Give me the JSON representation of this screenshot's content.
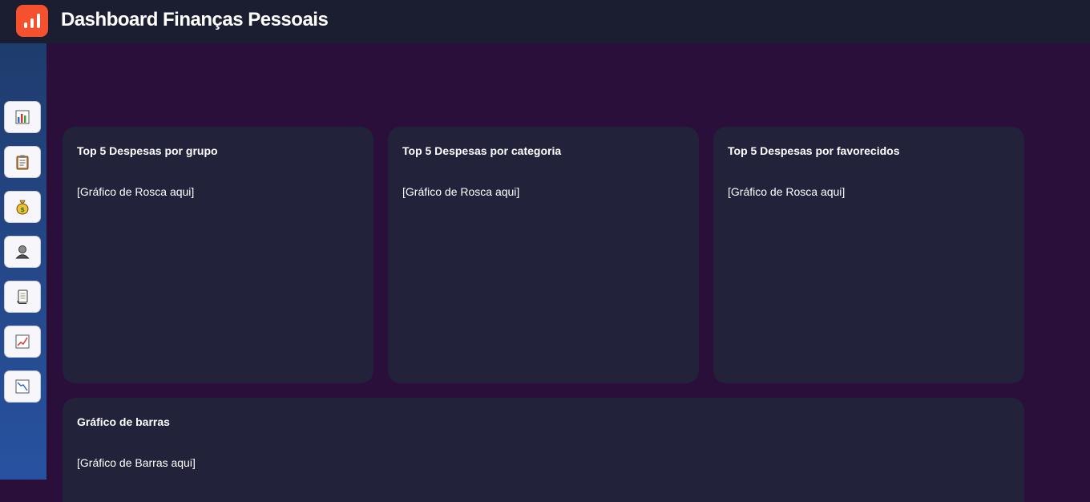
{
  "header": {
    "title": "Dashboard Finanças Pessoais",
    "logo_icon": "bar-chart-icon",
    "logo_color": "#f5512f"
  },
  "sidebar": {
    "items": [
      {
        "icon": "bar-chart-icon"
      },
      {
        "icon": "clipboard-icon"
      },
      {
        "icon": "money-bag-icon"
      },
      {
        "icon": "user-icon"
      },
      {
        "icon": "scroll-icon"
      },
      {
        "icon": "chart-increasing-icon"
      },
      {
        "icon": "chart-decreasing-icon"
      }
    ]
  },
  "cards": [
    {
      "title": "Top 5 Despesas por grupo",
      "placeholder": "[Gráfico de Rosca aqui]"
    },
    {
      "title": "Top 5 Despesas por categoria",
      "placeholder": "[Gráfico de Rosca aqui]"
    },
    {
      "title": "Top 5 Despesas por favorecidos",
      "placeholder": "[Gráfico de Rosca aqui]"
    },
    {
      "title": "Gráfico de barras",
      "placeholder": "[Gráfico de Barras aqui]"
    }
  ],
  "colors": {
    "background": "#2a0f3b",
    "topbar": "#1b1d31",
    "card": "#22223a",
    "sidebar_top": "#1f3c6e",
    "sidebar_bottom": "#2852a0"
  }
}
